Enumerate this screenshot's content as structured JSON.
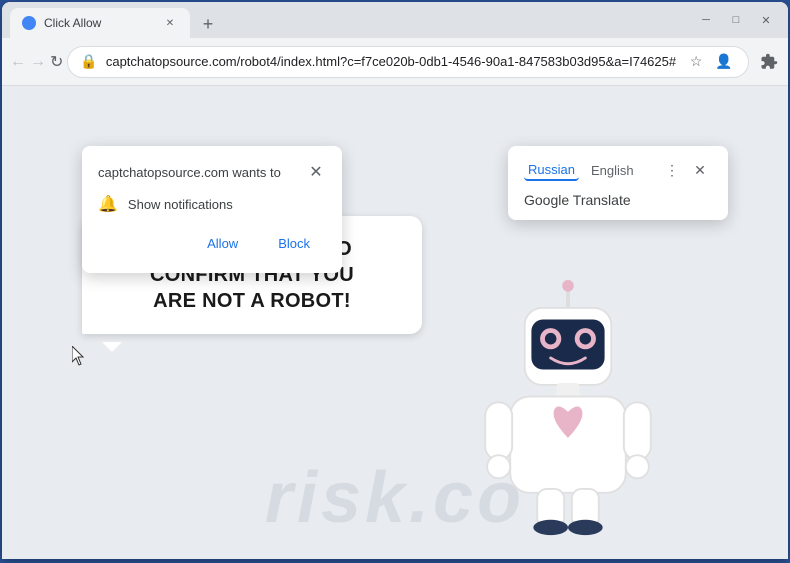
{
  "browser": {
    "title": "Click Allow",
    "tab_label": "Click Allow",
    "url": "captchatopsource.com/robot4/index.html?c=f7ce020b-0db1-4546-90a1-847583b03d95&a=I74625#",
    "new_tab_icon": "+",
    "back_icon": "←",
    "forward_icon": "→",
    "refresh_icon": "↻",
    "window_minimize": "─",
    "window_maximize": "□",
    "window_close": "✕"
  },
  "notification_popup": {
    "title": "captchatopsource.com wants to",
    "close_icon": "✕",
    "item_icon": "🔔",
    "item_text": "Show notifications",
    "allow_label": "Allow",
    "block_label": "Block"
  },
  "translate_popup": {
    "lang_russian": "Russian",
    "lang_english": "English",
    "service_name": "Google Translate",
    "more_icon": "⋮",
    "close_icon": "✕"
  },
  "page": {
    "captcha_message_line1": "CLICK «ALLOW» TO CONFIRM THAT YOU",
    "captcha_message_line2": "ARE NOT A ROBOT!",
    "watermark": "risk.co"
  },
  "colors": {
    "allow_color": "#1a73e8",
    "block_color": "#1a73e8",
    "active_lang": "#1a73e8",
    "border": "#2a5298"
  }
}
